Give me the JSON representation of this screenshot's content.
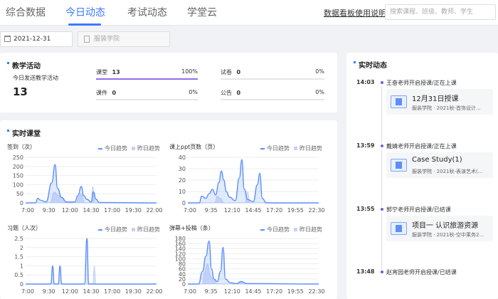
{
  "header": {
    "tabs": [
      {
        "label": "综合数据",
        "active": false
      },
      {
        "label": "今日动态",
        "active": true
      },
      {
        "label": "考试动态",
        "active": false
      },
      {
        "label": "学堂云",
        "active": false
      }
    ],
    "help_link": "数据看板使用说明",
    "search_placeholder": "搜索课程、班级、教师、学生"
  },
  "filters": {
    "date": "2021-12-31",
    "college_placeholder": "服装学院"
  },
  "teaching": {
    "title": "教学活动",
    "subtitle": "今日发送教学活动",
    "total": "13",
    "metrics": [
      {
        "label": "课堂",
        "value": "13",
        "percent_label": "100%",
        "fraction": 1.0
      },
      {
        "label": "试卷",
        "value": "0",
        "percent_label": "0%",
        "fraction": 0
      },
      {
        "label": "课件",
        "value": "0",
        "percent_label": "0%",
        "fraction": 0
      },
      {
        "label": "公告",
        "value": "0",
        "percent_label": "0%",
        "fraction": 0
      }
    ]
  },
  "realtime_class": {
    "title": "实时课堂",
    "legend_today": "今日趋势",
    "legend_yesterday": "昨日趋势"
  },
  "chart_data": [
    {
      "type": "area",
      "ylabel": "签到（次）",
      "yticks": [
        0,
        50,
        100,
        150,
        200,
        250
      ],
      "ylim": [
        0,
        250
      ],
      "xticks": [
        "7:00",
        "9:30",
        "12:00",
        "14:30",
        "17:00",
        "19:30",
        "22:00"
      ],
      "xlim": [
        7,
        23
      ],
      "series": [
        {
          "name": "今日趋势",
          "points": [
            [
              7,
              0
            ],
            [
              8.2,
              0
            ],
            [
              8.5,
              25
            ],
            [
              8.8,
              15
            ],
            [
              9.5,
              5
            ],
            [
              10.2,
              110
            ],
            [
              10.6,
              210
            ],
            [
              10.9,
              80
            ],
            [
              11.4,
              30
            ],
            [
              12,
              5
            ],
            [
              13,
              5
            ],
            [
              13.4,
              40
            ],
            [
              13.8,
              90
            ],
            [
              14.1,
              40
            ],
            [
              14.5,
              20
            ],
            [
              15,
              5
            ],
            [
              15.3,
              60
            ],
            [
              15.6,
              20
            ],
            [
              16,
              2
            ],
            [
              23,
              0
            ]
          ]
        },
        {
          "name": "昨日趋势",
          "points": [
            [
              7,
              0
            ],
            [
              10.0,
              0
            ],
            [
              10.5,
              60
            ],
            [
              11,
              40
            ],
            [
              11.5,
              30
            ],
            [
              12,
              0
            ],
            [
              13.2,
              0
            ],
            [
              13.5,
              30
            ],
            [
              13.8,
              50
            ],
            [
              14.2,
              0
            ],
            [
              15,
              0
            ],
            [
              15.2,
              90
            ],
            [
              15.5,
              0
            ],
            [
              23,
              0
            ]
          ]
        }
      ]
    },
    {
      "type": "area",
      "ylabel": "课上ppt页数（页）",
      "yticks": [
        0,
        10,
        20,
        30,
        40
      ],
      "ylim": [
        0,
        40
      ],
      "xticks": [
        "7:00",
        "9:35",
        "12:10",
        "14:45",
        "17:20",
        "19:55",
        "22:30"
      ],
      "xlim": [
        7,
        23
      ],
      "series": [
        {
          "name": "今日趋势",
          "points": [
            [
              7,
              0
            ],
            [
              8.4,
              0
            ],
            [
              8.7,
              6
            ],
            [
              9.2,
              4
            ],
            [
              9.6,
              8
            ],
            [
              10.0,
              12
            ],
            [
              10.4,
              7
            ],
            [
              10.8,
              18
            ],
            [
              11.1,
              28
            ],
            [
              11.4,
              20
            ],
            [
              11.7,
              10
            ],
            [
              12.1,
              5
            ],
            [
              12.8,
              2
            ],
            [
              13.3,
              22
            ],
            [
              13.6,
              38
            ],
            [
              13.9,
              12
            ],
            [
              14.3,
              3
            ],
            [
              15,
              1
            ],
            [
              15.5,
              16
            ],
            [
              15.8,
              26
            ],
            [
              16.1,
              4
            ],
            [
              16.6,
              0
            ],
            [
              23,
              0
            ]
          ]
        },
        {
          "name": "昨日趋势",
          "points": [
            [
              7,
              0
            ],
            [
              10.3,
              0
            ],
            [
              10.6,
              6
            ],
            [
              11,
              4
            ],
            [
              11.4,
              0
            ],
            [
              14.0,
              0
            ],
            [
              14.3,
              10
            ],
            [
              14.6,
              0
            ],
            [
              23,
              0
            ]
          ]
        }
      ]
    },
    {
      "type": "area",
      "ylabel": "习题（人次）",
      "yticks": [
        0,
        0.5,
        1,
        1.5,
        2,
        2.5
      ],
      "ylim": [
        0,
        2.5
      ],
      "xticks": [
        "7:00",
        "9:30",
        "12:00",
        "14:30",
        "17:00",
        "19:30",
        "22:00"
      ],
      "xlim": [
        7,
        23
      ],
      "series": [
        {
          "name": "今日趋势",
          "points": [
            [
              7,
              0
            ],
            [
              10.1,
              0
            ],
            [
              10.3,
              1
            ],
            [
              10.5,
              0
            ],
            [
              11.0,
              0
            ],
            [
              11.2,
              1
            ],
            [
              11.4,
              0
            ],
            [
              14.2,
              0
            ],
            [
              14.5,
              2.5
            ],
            [
              14.7,
              0
            ],
            [
              23,
              0
            ]
          ]
        },
        {
          "name": "昨日趋势",
          "points": [
            [
              7,
              0
            ],
            [
              15.2,
              0
            ],
            [
              15.4,
              1
            ],
            [
              15.6,
              0
            ],
            [
              23,
              0
            ]
          ]
        }
      ]
    },
    {
      "type": "area",
      "ylabel": "弹幕+投稿（条）",
      "yticks": [
        0,
        20,
        40,
        60,
        80,
        100,
        120,
        140,
        160,
        180
      ],
      "ylim": [
        0,
        180
      ],
      "xticks": [
        "7:00",
        "9:35",
        "12:10",
        "14:45",
        "17:20",
        "19:55",
        "22:30"
      ],
      "xlim": [
        7,
        23
      ],
      "series": [
        {
          "name": "今日趋势",
          "points": [
            [
              7,
              0
            ],
            [
              8.3,
              0
            ],
            [
              8.8,
              50
            ],
            [
              9.2,
              110
            ],
            [
              9.6,
              170
            ],
            [
              9.9,
              60
            ],
            [
              10.2,
              20
            ],
            [
              10.6,
              10
            ],
            [
              11,
              50
            ],
            [
              11.3,
              145
            ],
            [
              11.6,
              20
            ],
            [
              12.2,
              5
            ],
            [
              13,
              2
            ],
            [
              13.5,
              10
            ],
            [
              14.2,
              2
            ],
            [
              23,
              0
            ]
          ]
        },
        {
          "name": "昨日趋势",
          "points": [
            [
              7,
              0
            ],
            [
              8.8,
              0
            ],
            [
              9.0,
              45
            ],
            [
              9.4,
              80
            ],
            [
              9.8,
              30
            ],
            [
              10.2,
              15
            ],
            [
              10.6,
              0
            ],
            [
              13.2,
              0
            ],
            [
              13.5,
              12
            ],
            [
              13.8,
              0
            ],
            [
              23,
              0
            ]
          ]
        }
      ]
    }
  ],
  "feed": {
    "title": "实时动态",
    "events": [
      {
        "time": "14:03",
        "text": "王奋老师开启授课/正在上课",
        "course": "12月31日授课",
        "meta": "服装学院 · 2021秋-首饰设计..."
      },
      {
        "time": "13:59",
        "text": "戴婧老师开启授课/正在上课",
        "course": "Case Study(1)",
        "meta": "服装学院 · 2021秋-表演艺术(..."
      },
      {
        "time": "13:55",
        "text": "郭宁老师开启授课/已结课",
        "course": "项目一 认识旅游资源",
        "meta": "服装学院 · 2021秋-空中乘务2..."
      },
      {
        "time": "13:48",
        "text": "赵宵园老师开启授课/已结课",
        "course": "",
        "meta": ""
      }
    ]
  }
}
